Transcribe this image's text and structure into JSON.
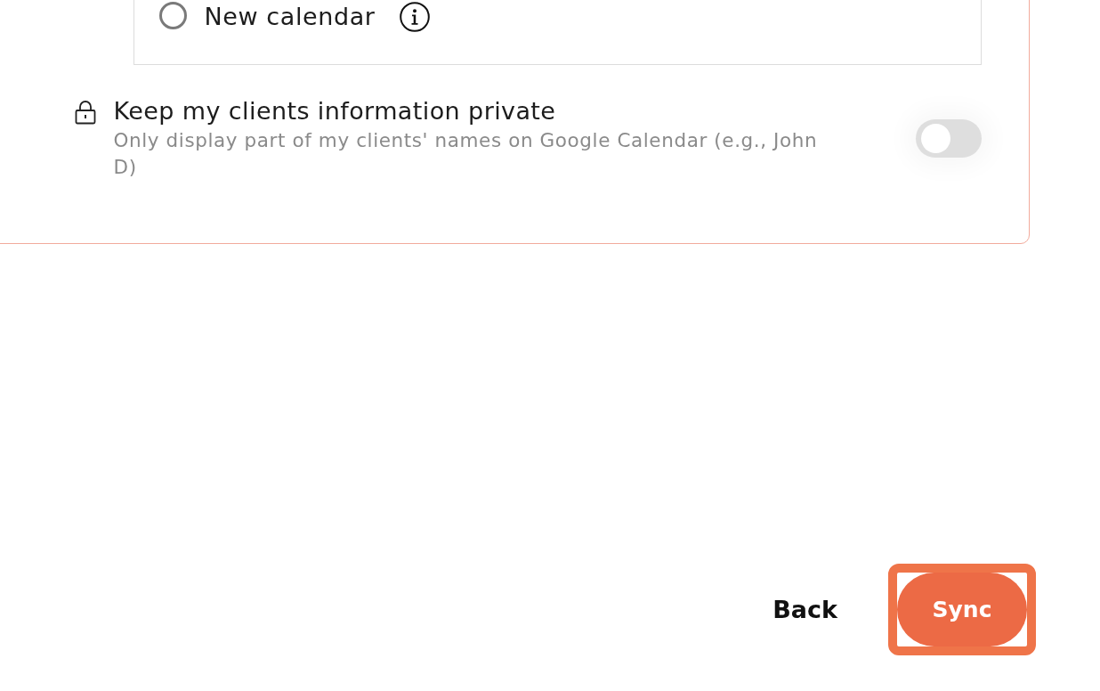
{
  "calendar_options": [
    {
      "label": "New calendar",
      "selected": false
    }
  ],
  "privacy": {
    "title": "Keep my clients information private",
    "description": "Only display part of my clients' names on Google Calendar (e.g., John D)",
    "on": false
  },
  "buttons": [
    {
      "label": "Back",
      "kind": "text",
      "highlighted": false
    },
    {
      "label": "Sync",
      "kind": "primary",
      "highlighted": true
    }
  ]
}
